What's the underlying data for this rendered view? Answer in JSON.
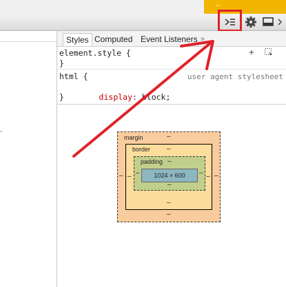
{
  "window": {
    "minimize_glyph": "–"
  },
  "toolbar": {
    "icons": [
      "dock-side-icon",
      "gear-icon",
      "undock-icon",
      "close-icon"
    ],
    "more_glyph": "»"
  },
  "tabs": [
    {
      "label": "Styles",
      "active": true
    },
    {
      "label": "Computed",
      "active": false
    },
    {
      "label": "Event Listeners",
      "active": false
    }
  ],
  "rules": {
    "element_style": {
      "selector": "element.style {",
      "close": "}"
    },
    "html_rule": {
      "selector": "html {",
      "property": "display",
      "value": ": block;",
      "close": "}",
      "source": "user agent stylesheet"
    }
  },
  "box_model": {
    "margin_label": "margin",
    "border_label": "border",
    "padding_label": "padding",
    "content": "1024 × 600",
    "dash": "–"
  },
  "colors": {
    "accent": "#f2b600",
    "annotation": "#e0222a",
    "margin": "#f9cc9d",
    "border": "#fddd9b",
    "padding": "#c2cf8a",
    "content": "#8cb6c0"
  }
}
